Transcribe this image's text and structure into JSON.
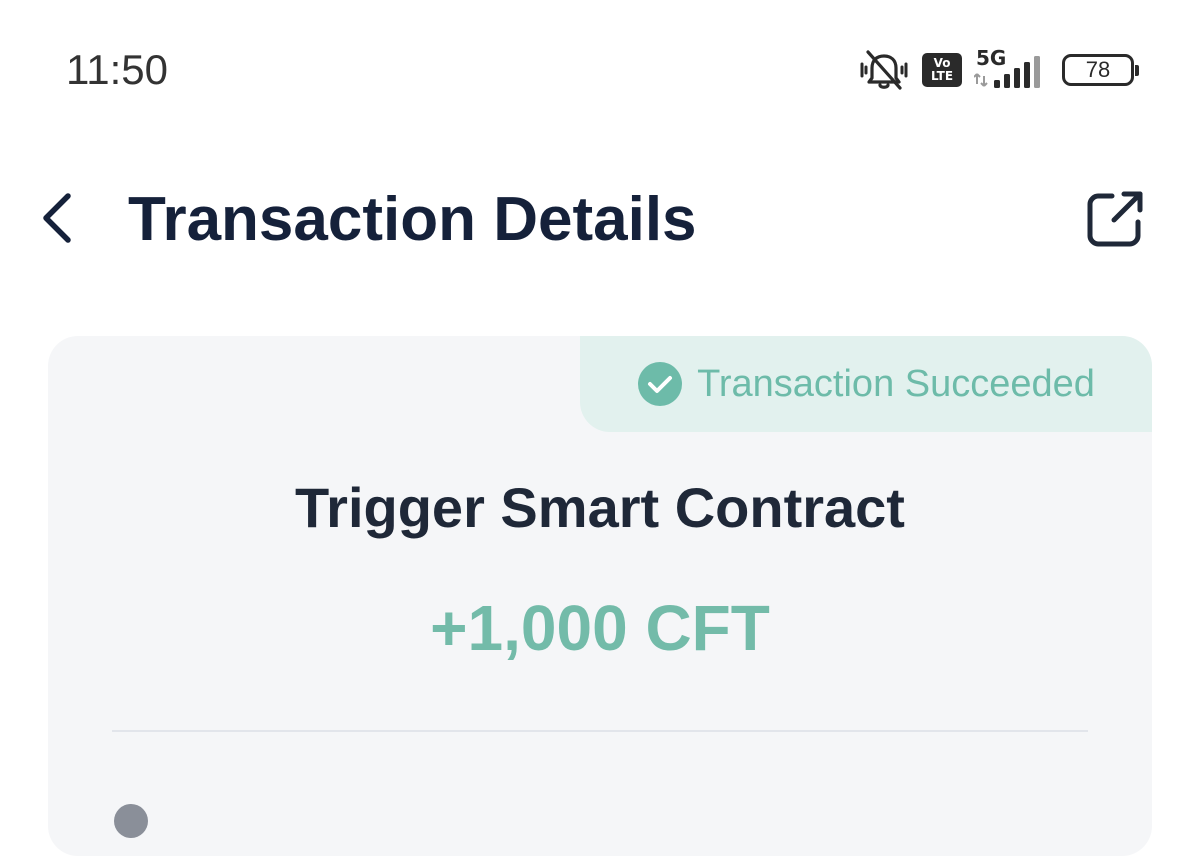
{
  "status_bar": {
    "time": "11:50",
    "volte_top": "Vo",
    "volte_bottom": "LTE",
    "network": "5G",
    "battery_level": "78",
    "icons": [
      "mute-icon",
      "volte-icon",
      "signal-icon",
      "battery-icon"
    ]
  },
  "header": {
    "title": "Transaction Details",
    "back_icon": "chevron-left-icon",
    "share_icon": "external-link-icon"
  },
  "card": {
    "status_label": "Transaction Succeeded",
    "status_icon": "check-circle-icon",
    "transaction_type": "Trigger Smart Contract",
    "amount": "+1,000 CFT"
  },
  "colors": {
    "title": "#15213a",
    "success": "#6dbba9",
    "success_bg": "#e2f1ee",
    "card_bg": "#f5f6f8"
  }
}
